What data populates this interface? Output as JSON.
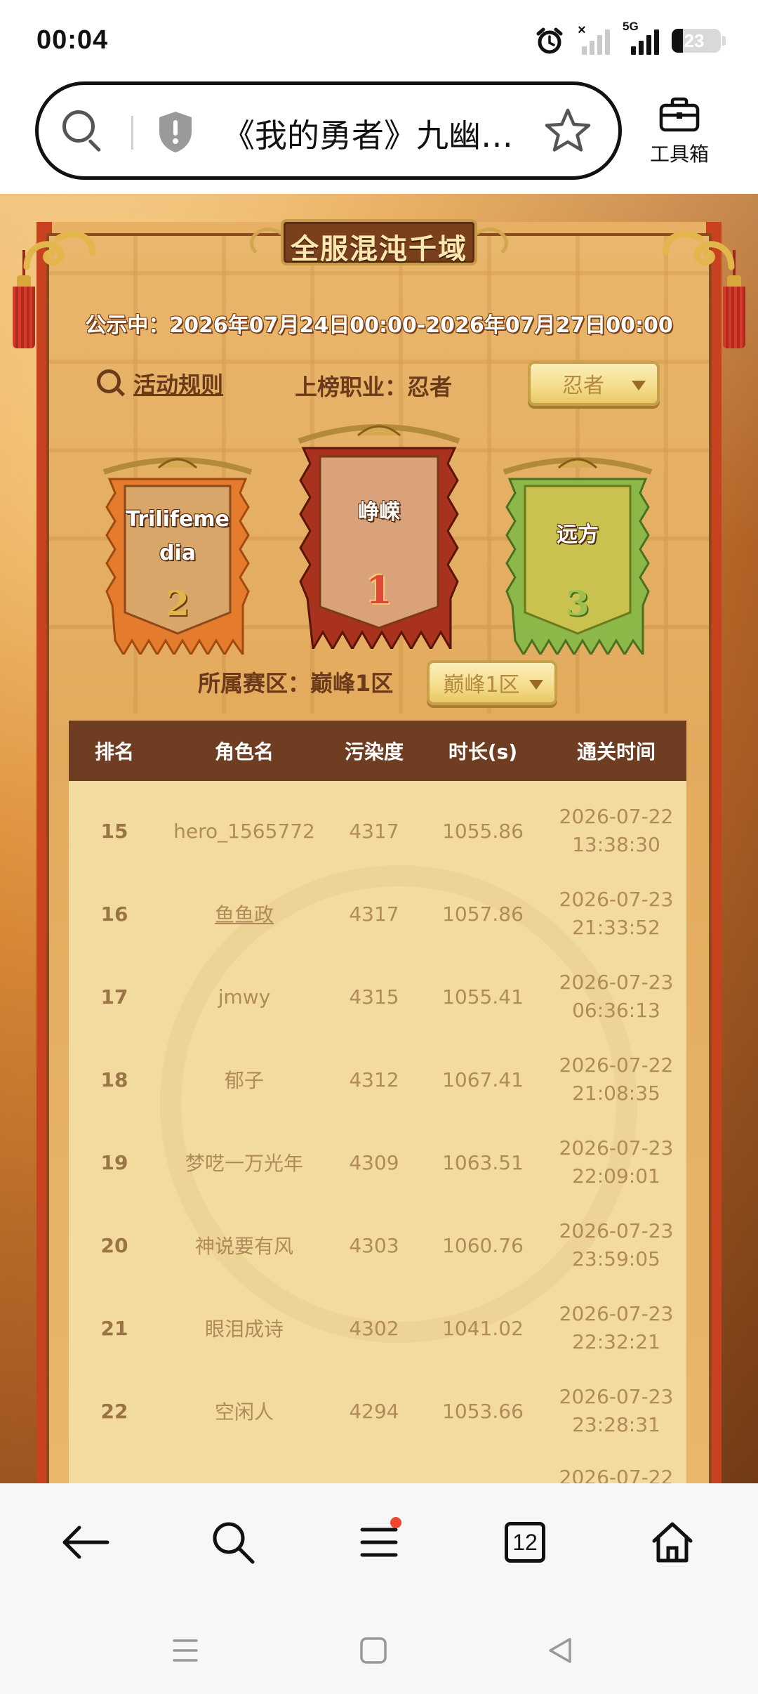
{
  "status_bar": {
    "time": "00:04",
    "network_type": "5G",
    "battery_level": "23",
    "icons": [
      "alarm-icon",
      "signal-no-service-icon",
      "signal-5g-icon",
      "battery-icon"
    ]
  },
  "address_bar": {
    "url_title": "《我的勇者》九幽…",
    "toolbox_label": "工具箱",
    "icons": [
      "search-icon",
      "shield-warning-icon",
      "star-icon",
      "toolbox-icon"
    ]
  },
  "page": {
    "title": "全服混沌千域",
    "notice": "公示中：2026年07月24日00:00-2026年07月27日00:00",
    "rules_link": "活动规则",
    "job_label": "上榜职业：忍者",
    "job_select_value": "忍者",
    "zone_label": "所属赛区：巅峰1区",
    "zone_select_value": "巅峰1区"
  },
  "podium": [
    {
      "rank": "1",
      "name": "峥嵘",
      "color": "#a8321e"
    },
    {
      "rank": "2",
      "name": "Trilifeme\ndia",
      "color": "#e57b2c"
    },
    {
      "rank": "3",
      "name": "远方",
      "color": "#8cb84a"
    }
  ],
  "table": {
    "headers": [
      "排名",
      "角色名",
      "污染度",
      "时长(s)",
      "通关时间"
    ],
    "rows": [
      {
        "rank": "15",
        "name": "hero_1565772",
        "pollution": "4317",
        "duration": "1055.86",
        "time": "2026-07-22\n13:38:30"
      },
      {
        "rank": "16",
        "name": "鱼鱼政",
        "pollution": "4317",
        "duration": "1057.86",
        "time": "2026-07-23\n21:33:52"
      },
      {
        "rank": "17",
        "name": "jmwy",
        "pollution": "4315",
        "duration": "1055.41",
        "time": "2026-07-23\n06:36:13"
      },
      {
        "rank": "18",
        "name": "郁子",
        "pollution": "4312",
        "duration": "1067.41",
        "time": "2026-07-22\n21:08:35"
      },
      {
        "rank": "19",
        "name": "梦呓一万光年",
        "pollution": "4309",
        "duration": "1063.51",
        "time": "2026-07-23\n22:09:01"
      },
      {
        "rank": "20",
        "name": "神说要有风",
        "pollution": "4303",
        "duration": "1060.76",
        "time": "2026-07-23\n23:59:05"
      },
      {
        "rank": "21",
        "name": "眼泪成诗",
        "pollution": "4302",
        "duration": "1041.02",
        "time": "2026-07-23\n22:32:21"
      },
      {
        "rank": "22",
        "name": "空闲人",
        "pollution": "4294",
        "duration": "1053.66",
        "time": "2026-07-23\n23:28:31"
      },
      {
        "rank": "",
        "name": "",
        "pollution": "",
        "duration": "",
        "time": "2026-07-22"
      }
    ]
  },
  "bottom_nav": {
    "tab_count": "12",
    "icons": [
      "back-arrow-icon",
      "search-icon",
      "menu-icon",
      "tabs-icon",
      "home-icon"
    ]
  },
  "system_nav": {
    "icons": [
      "recents-icon",
      "home-square-icon",
      "back-triangle-icon"
    ]
  }
}
